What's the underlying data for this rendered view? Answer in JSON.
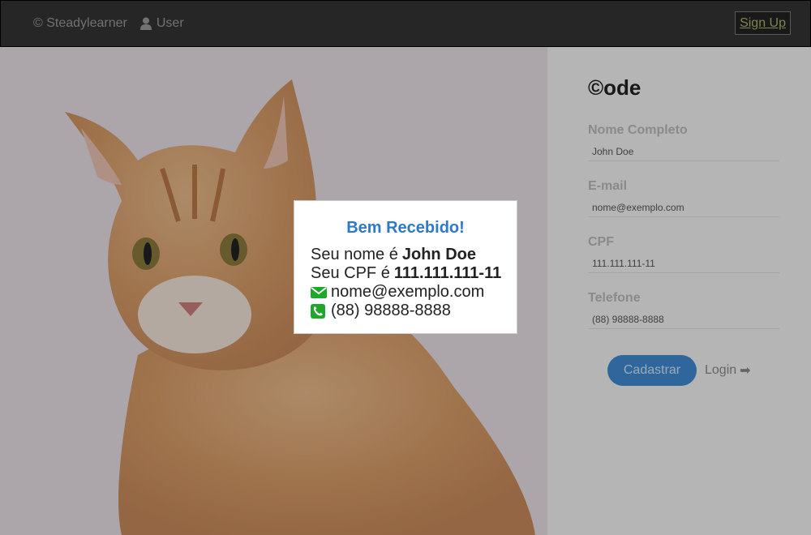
{
  "navbar": {
    "brand": "© Steadylearner",
    "user_label": "User",
    "signup_label": "Sign Up"
  },
  "form": {
    "title": "©ode",
    "fields": [
      {
        "label": "Nome Completo",
        "value": "John Doe"
      },
      {
        "label": "E-mail",
        "value": "nome@exemplo.com"
      },
      {
        "label": "CPF",
        "value": "111.111.111-11"
      },
      {
        "label": "Telefone",
        "value": "(88) 98888-8888"
      }
    ],
    "submit_label": "Cadastrar",
    "login_label": "Login",
    "login_arrow": "➡"
  },
  "modal": {
    "title": "Bem Recebido!",
    "name_prefix": "Seu nome é",
    "name": "John Doe",
    "cpf_prefix": "Seu CPF é",
    "cpf": "111.111.111-11",
    "email": "nome@exemplo.com",
    "phone": "(88) 98888-8888"
  },
  "icons": {
    "user": "user-icon",
    "envelope": "envelope-icon",
    "phone": "phone-icon",
    "accent": "#2e7ac9",
    "green": "#1ea82a"
  }
}
